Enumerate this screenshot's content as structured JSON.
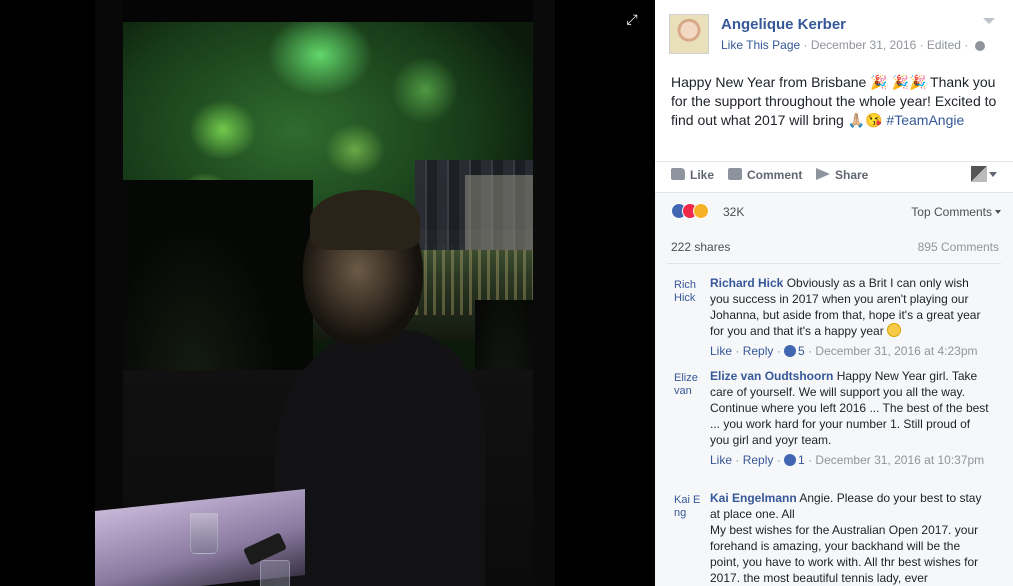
{
  "post": {
    "page_name": "Angelique Kerber",
    "like_page": "Like This Page",
    "separator": " · ",
    "date": "December 31, 2016",
    "edited": "Edited",
    "text_main": "Happy New Year from Brisbane 🎉 🎉🎉 Thank you for the support throughout the whole year! Excited to find out what 2017 will bring 🙏🏼😘",
    "hashtag": "#TeamAngie"
  },
  "actions": {
    "like": "Like",
    "comment": "Comment",
    "share": "Share"
  },
  "reactions": {
    "count": "32K",
    "sort_label": "Top Comments"
  },
  "stats": {
    "shares": "222 shares",
    "comments": "895 Comments"
  },
  "comments": [
    {
      "avatar_text": "Rich Hick",
      "author": "Richard Hick",
      "text": "Obviously as a Brit I can only wish you success in 2017 when you aren't playing our Johanna, but aside from that, hope it's a great year for you and that it's a happy year",
      "like": "Like",
      "reply": "Reply",
      "likes": "5",
      "time": "December 31, 2016 at 4:23pm"
    },
    {
      "avatar_text": "Elize van",
      "author": "Elize van Oudtshoorn",
      "text": "Happy New Year girl. Take care of yourself. We will support you all the way. Continue where you left 2016 ... The best of the best ... you work hard for your number 1. Still proud of you girl and yoyr team.",
      "like": "Like",
      "reply": "Reply",
      "likes": "1",
      "time": "December 31, 2016 at 10:37pm"
    },
    {
      "avatar_text": "Kai Eng",
      "author": "Kai Engelmann",
      "text": "Angie. Please do your best to stay at place one. All",
      "text2": "My best wishes for the Australian Open 2017. your forehand is amazing, your backhand will be the point, you have to work with. All thr best wishes for 2017. the most beautiful tennis lady, ever"
    }
  ],
  "colors": {
    "link": "#365899",
    "background": "#000000",
    "panel": "#ffffff"
  }
}
